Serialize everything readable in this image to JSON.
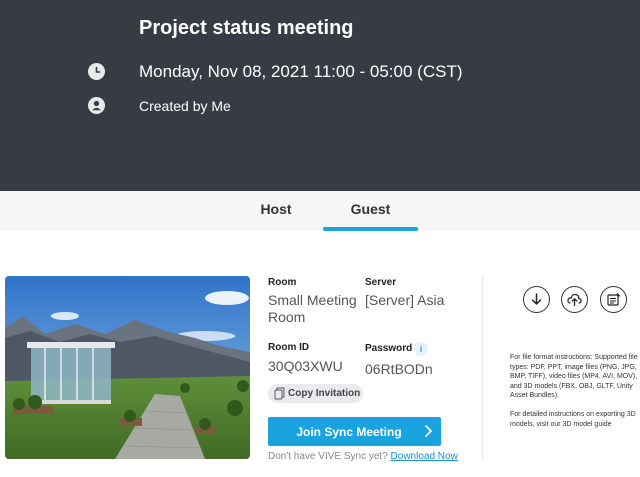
{
  "meeting": {
    "title": "Project status meeting",
    "datetime": "Monday, Nov 08, 2021  11:00 - 05:00 (CST)",
    "created_by": "Created by Me"
  },
  "tabs": [
    {
      "label": "Host",
      "selected": false
    },
    {
      "label": "Guest",
      "selected": true
    }
  ],
  "room": {
    "room_label": "Room",
    "room_value": "Small Meeting Room",
    "server_label": "Server",
    "server_value": "[Server] Asia",
    "room_id_label": "Room ID",
    "room_id_value": "30Q03XWU",
    "password_label": "Password",
    "password_value": "06RtBODn",
    "info_icon_glyph": "i",
    "copy_invitation": "Copy Invitation",
    "join_button": "Join Sync Meeting",
    "no_vive_text": "Don't have VIVE Sync yet?",
    "download_link": "Download Now"
  },
  "instructions": {
    "file_format": "For file format instructions: Supported file types: PDF, PPT, image files (PNG, JPG, BMP, TIFF), video files (MP4, AVI, MOV), and 3D models (FBX, OBJ, GLTF, Unity Asset Bundles).",
    "export_3d": "For detailed instructions on exporting 3D models, visit our 3D model guide"
  },
  "icons": {
    "datetime": "clock-icon",
    "creator": "user-icon",
    "download": "download-icon",
    "upload": "cloud-upload-icon",
    "notes": "notes-icon",
    "copy": "copy-icon",
    "join": "chevron-right-icon"
  },
  "colors": {
    "header_bg": "#363b44",
    "accent": "#19a3df",
    "tab_bar_bg": "#f5f6f8"
  }
}
